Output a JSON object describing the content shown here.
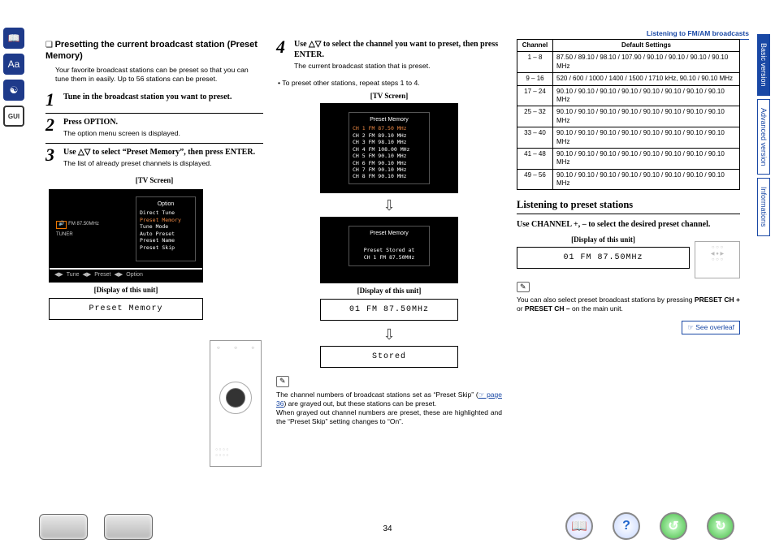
{
  "header": {
    "breadcrumb": "Listening to FM/AM broadcasts"
  },
  "side_tabs": {
    "items": [
      {
        "label": "Basic version",
        "active": true
      },
      {
        "label": "Advanced version",
        "active": false
      },
      {
        "label": "Informations",
        "active": false
      }
    ]
  },
  "col1": {
    "square": "❏",
    "heading": "Presetting the current broadcast station (Preset Memory)",
    "intro": "Your favorite broadcast stations can be preset so that you can tune them in easily. Up to 56 stations can be preset.",
    "steps": [
      {
        "num": "1",
        "main": "Tune in the broadcast station you want to preset.",
        "sub": ""
      },
      {
        "num": "2",
        "main": "Press OPTION.",
        "sub": "The option menu screen is displayed."
      },
      {
        "num": "3",
        "main": "Use △▽ to select “Preset Memory”, then press ENTER.",
        "sub": "The list of already preset channels is displayed."
      }
    ],
    "tv_label": "[TV Screen]",
    "tv_options_title": "Option",
    "tv_options": [
      "Direct Tune",
      "Preset Memory",
      "Tune Mode",
      "Auto Preset",
      "Preset Name",
      "Preset Skip"
    ],
    "tv_left_tuner": "TUNER",
    "tv_left_freq": "FM  87.50MHz",
    "tv_foot": [
      "Tune",
      "Preset",
      "Option"
    ],
    "display_label": "[Display of this unit]",
    "display_text": "Preset Memory"
  },
  "col2": {
    "step4_num": "4",
    "step4_main": "Use △▽ to select the channel you want to preset, then press ENTER.",
    "step4_sub": "The current broadcast station that is preset.",
    "repeat_note": "• To preset other stations, repeat steps 1 to 4.",
    "tv_label": "[TV Screen]",
    "preset_title": "Preset Memory",
    "preset_lines": [
      "CH 1  FM    87.50 MHz",
      "CH 2  FM    89.10 MHz",
      "CH 3  FM    98.10 MHz",
      "CH 4  FM   108.00 MHz",
      "CH 5  FM    90.10 MHz",
      "CH 6  FM    90.10 MHz",
      "CH 7  FM    90.10 MHz",
      "CH 8  FM    90.10 MHz"
    ],
    "stored_title": "Preset Memory",
    "stored_line1": "Preset Stored at",
    "stored_line2": "CH 1 FM 87.50MHz",
    "display_label": "[Display of this unit]",
    "display1": "01 FM  87.50MHz",
    "display2": "Stored",
    "note_body1": "The channel numbers of broadcast stations set as “Preset Skip” (",
    "note_link": "☞ page 36",
    "note_body1b": ") are grayed out, but these stations can be preset.",
    "note_body2": "When grayed out channel numbers are preset, these are highlighted and the “Preset Skip” setting changes to “On”."
  },
  "col3": {
    "table": {
      "headers": [
        "Channel",
        "Default Settings"
      ],
      "rows": [
        [
          "1 – 8",
          "87.50 / 89.10 / 98.10 / 107.90 / 90.10 / 90.10 / 90.10 / 90.10 MHz"
        ],
        [
          "9 – 16",
          "520 / 600 / 1000 / 1400 / 1500 / 1710 kHz, 90.10 / 90.10 MHz"
        ],
        [
          "17 – 24",
          "90.10 / 90.10 / 90.10 / 90.10 / 90.10 / 90.10 / 90.10 / 90.10 MHz"
        ],
        [
          "25 – 32",
          "90.10 / 90.10 / 90.10 / 90.10 / 90.10 / 90.10 / 90.10 / 90.10 MHz"
        ],
        [
          "33 – 40",
          "90.10 / 90.10 / 90.10 / 90.10 / 90.10 / 90.10 / 90.10 / 90.10 MHz"
        ],
        [
          "41 – 48",
          "90.10 / 90.10 / 90.10 / 90.10 / 90.10 / 90.10 / 90.10 / 90.10 MHz"
        ],
        [
          "49 – 56",
          "90.10 / 90.10 / 90.10 / 90.10 / 90.10 / 90.10 / 90.10 / 90.10 MHz"
        ]
      ]
    },
    "sec_title": "Listening to preset stations",
    "use_line": "Use CHANNEL +, – to select the desired preset channel.",
    "display_label": "[Display of this unit]",
    "display_text": "01 FM  87.50MHz",
    "note_body_a": "You can also select preset broadcast stations by pressing ",
    "note_bold1": "PRESET CH +",
    "note_mid": " or ",
    "note_bold2": "PRESET CH –",
    "note_tail": " on the main unit.",
    "see_overleaf": "☞ See overleaf"
  },
  "footer": {
    "page_num": "34"
  }
}
